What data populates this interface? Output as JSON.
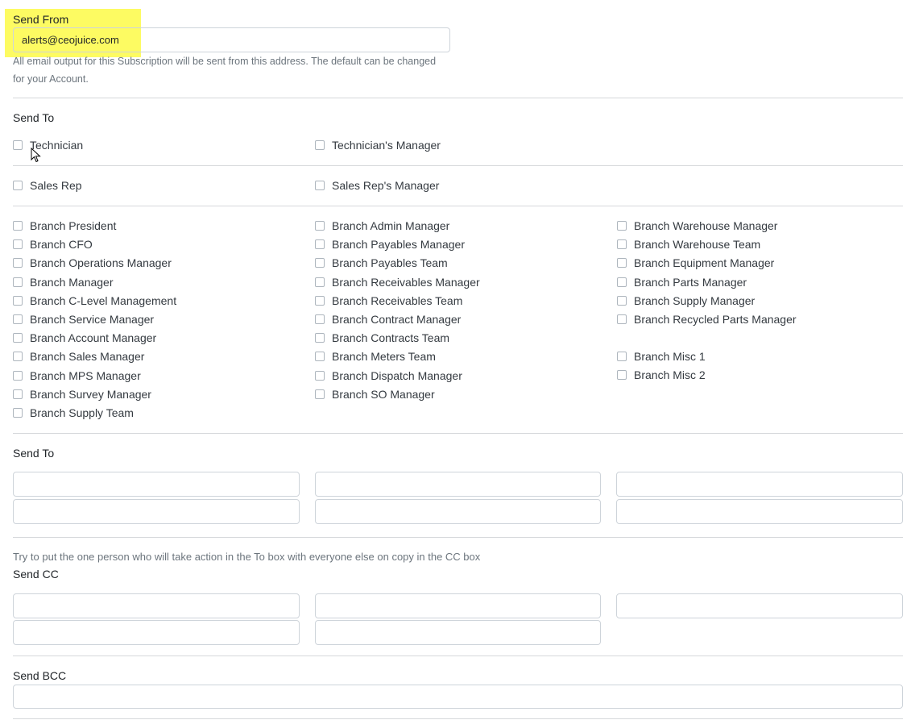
{
  "send_from": {
    "label": "Send From",
    "value": "alerts@ceojuice.com",
    "help_line1": "All email output for this Subscription will be sent from this address. The default can be changed",
    "help_line2": "for your Account."
  },
  "send_to_checks": {
    "label": "Send To",
    "group1": [
      "Technician",
      "Technician's Manager"
    ],
    "group2": [
      "Sales Rep",
      "Sales Rep's Manager"
    ],
    "col1": [
      "Branch President",
      "Branch CFO",
      "Branch Operations Manager",
      "Branch Manager",
      "Branch C-Level Management",
      "Branch Service Manager",
      "Branch Account Manager",
      "Branch Sales Manager",
      "Branch MPS Manager",
      "Branch Survey Manager",
      "Branch Supply Team"
    ],
    "col2": [
      "Branch Admin Manager",
      "Branch Payables Manager",
      "Branch Payables Team",
      "Branch Receivables Manager",
      "Branch Receivables Team",
      "Branch Contract Manager",
      "Branch Contracts Team",
      "Branch Meters Team",
      "Branch Dispatch Manager",
      "Branch SO Manager"
    ],
    "col3a": [
      "Branch Warehouse Manager",
      "Branch Warehouse Team",
      "Branch Equipment Manager",
      "Branch Parts Manager",
      "Branch Supply Manager",
      "Branch Recycled Parts Manager"
    ],
    "col3b": [
      "Branch Misc 1",
      "Branch Misc 2"
    ]
  },
  "send_to_fields": {
    "label": "Send To"
  },
  "send_cc": {
    "hint": "Try to put the one person who will take action in the To box with everyone else on copy in the CC box",
    "label": "Send CC"
  },
  "send_bcc": {
    "label": "Send BCC"
  }
}
